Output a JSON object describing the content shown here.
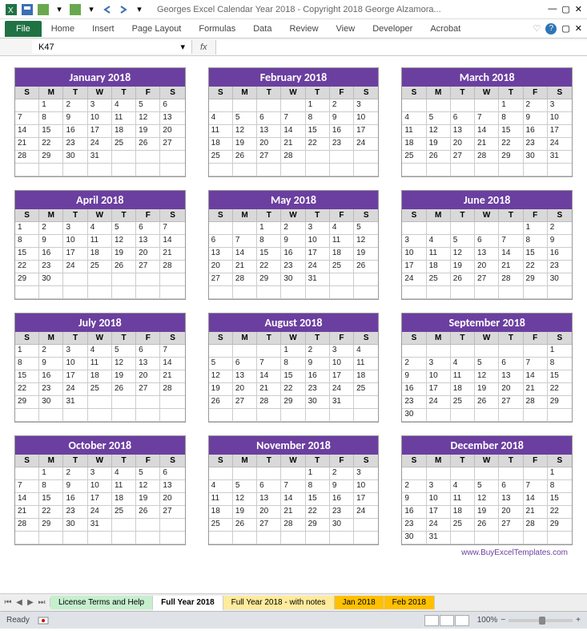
{
  "window_title": "Georges Excel Calendar Year 2018  -  Copyright 2018 George Alzamora...",
  "ribbon": {
    "file": "File",
    "tabs": [
      "Home",
      "Insert",
      "Page Layout",
      "Formulas",
      "Data",
      "Review",
      "View",
      "Developer",
      "Acrobat"
    ]
  },
  "namebox": "K47",
  "fx": "fx",
  "dow": [
    "S",
    "M",
    "T",
    "W",
    "T",
    "F",
    "S"
  ],
  "months": [
    {
      "title": "January 2018",
      "rows": [
        [
          "",
          "1",
          "2",
          "3",
          "4",
          "5",
          "6"
        ],
        [
          "7",
          "8",
          "9",
          "10",
          "11",
          "12",
          "13"
        ],
        [
          "14",
          "15",
          "16",
          "17",
          "18",
          "19",
          "20"
        ],
        [
          "21",
          "22",
          "23",
          "24",
          "25",
          "26",
          "27"
        ],
        [
          "28",
          "29",
          "30",
          "31",
          "",
          "",
          ""
        ],
        [
          "",
          "",
          "",
          "",
          "",
          "",
          ""
        ]
      ]
    },
    {
      "title": "February 2018",
      "rows": [
        [
          "",
          "",
          "",
          "",
          "1",
          "2",
          "3"
        ],
        [
          "4",
          "5",
          "6",
          "7",
          "8",
          "9",
          "10"
        ],
        [
          "11",
          "12",
          "13",
          "14",
          "15",
          "16",
          "17"
        ],
        [
          "18",
          "19",
          "20",
          "21",
          "22",
          "23",
          "24"
        ],
        [
          "25",
          "26",
          "27",
          "28",
          "",
          "",
          ""
        ],
        [
          "",
          "",
          "",
          "",
          "",
          "",
          ""
        ]
      ]
    },
    {
      "title": "March 2018",
      "rows": [
        [
          "",
          "",
          "",
          "",
          "1",
          "2",
          "3"
        ],
        [
          "4",
          "5",
          "6",
          "7",
          "8",
          "9",
          "10"
        ],
        [
          "11",
          "12",
          "13",
          "14",
          "15",
          "16",
          "17"
        ],
        [
          "18",
          "19",
          "20",
          "21",
          "22",
          "23",
          "24"
        ],
        [
          "25",
          "26",
          "27",
          "28",
          "29",
          "30",
          "31"
        ],
        [
          "",
          "",
          "",
          "",
          "",
          "",
          ""
        ]
      ]
    },
    {
      "title": "April 2018",
      "rows": [
        [
          "1",
          "2",
          "3",
          "4",
          "5",
          "6",
          "7"
        ],
        [
          "8",
          "9",
          "10",
          "11",
          "12",
          "13",
          "14"
        ],
        [
          "15",
          "16",
          "17",
          "18",
          "19",
          "20",
          "21"
        ],
        [
          "22",
          "23",
          "24",
          "25",
          "26",
          "27",
          "28"
        ],
        [
          "29",
          "30",
          "",
          "",
          "",
          "",
          ""
        ],
        [
          "",
          "",
          "",
          "",
          "",
          "",
          ""
        ]
      ]
    },
    {
      "title": "May 2018",
      "rows": [
        [
          "",
          "",
          "1",
          "2",
          "3",
          "4",
          "5"
        ],
        [
          "6",
          "7",
          "8",
          "9",
          "10",
          "11",
          "12"
        ],
        [
          "13",
          "14",
          "15",
          "16",
          "17",
          "18",
          "19"
        ],
        [
          "20",
          "21",
          "22",
          "23",
          "24",
          "25",
          "26"
        ],
        [
          "27",
          "28",
          "29",
          "30",
          "31",
          "",
          ""
        ],
        [
          "",
          "",
          "",
          "",
          "",
          "",
          ""
        ]
      ]
    },
    {
      "title": "June 2018",
      "rows": [
        [
          "",
          "",
          "",
          "",
          "",
          "1",
          "2"
        ],
        [
          "3",
          "4",
          "5",
          "6",
          "7",
          "8",
          "9"
        ],
        [
          "10",
          "11",
          "12",
          "13",
          "14",
          "15",
          "16"
        ],
        [
          "17",
          "18",
          "19",
          "20",
          "21",
          "22",
          "23"
        ],
        [
          "24",
          "25",
          "26",
          "27",
          "28",
          "29",
          "30"
        ],
        [
          "",
          "",
          "",
          "",
          "",
          "",
          ""
        ]
      ]
    },
    {
      "title": "July 2018",
      "rows": [
        [
          "1",
          "2",
          "3",
          "4",
          "5",
          "6",
          "7"
        ],
        [
          "8",
          "9",
          "10",
          "11",
          "12",
          "13",
          "14"
        ],
        [
          "15",
          "16",
          "17",
          "18",
          "19",
          "20",
          "21"
        ],
        [
          "22",
          "23",
          "24",
          "25",
          "26",
          "27",
          "28"
        ],
        [
          "29",
          "30",
          "31",
          "",
          "",
          "",
          ""
        ],
        [
          "",
          "",
          "",
          "",
          "",
          "",
          ""
        ]
      ]
    },
    {
      "title": "August 2018",
      "rows": [
        [
          "",
          "",
          "",
          "1",
          "2",
          "3",
          "4"
        ],
        [
          "5",
          "6",
          "7",
          "8",
          "9",
          "10",
          "11"
        ],
        [
          "12",
          "13",
          "14",
          "15",
          "16",
          "17",
          "18"
        ],
        [
          "19",
          "20",
          "21",
          "22",
          "23",
          "24",
          "25"
        ],
        [
          "26",
          "27",
          "28",
          "29",
          "30",
          "31",
          ""
        ],
        [
          "",
          "",
          "",
          "",
          "",
          "",
          ""
        ]
      ]
    },
    {
      "title": "September 2018",
      "rows": [
        [
          "",
          "",
          "",
          "",
          "",
          "",
          "1"
        ],
        [
          "2",
          "3",
          "4",
          "5",
          "6",
          "7",
          "8"
        ],
        [
          "9",
          "10",
          "11",
          "12",
          "13",
          "14",
          "15"
        ],
        [
          "16",
          "17",
          "18",
          "19",
          "20",
          "21",
          "22"
        ],
        [
          "23",
          "24",
          "25",
          "26",
          "27",
          "28",
          "29"
        ],
        [
          "30",
          "",
          "",
          "",
          "",
          "",
          ""
        ]
      ]
    },
    {
      "title": "October 2018",
      "rows": [
        [
          "",
          "1",
          "2",
          "3",
          "4",
          "5",
          "6"
        ],
        [
          "7",
          "8",
          "9",
          "10",
          "11",
          "12",
          "13"
        ],
        [
          "14",
          "15",
          "16",
          "17",
          "18",
          "19",
          "20"
        ],
        [
          "21",
          "22",
          "23",
          "24",
          "25",
          "26",
          "27"
        ],
        [
          "28",
          "29",
          "30",
          "31",
          "",
          "",
          ""
        ],
        [
          "",
          "",
          "",
          "",
          "",
          "",
          ""
        ]
      ]
    },
    {
      "title": "November 2018",
      "rows": [
        [
          "",
          "",
          "",
          "",
          "1",
          "2",
          "3"
        ],
        [
          "4",
          "5",
          "6",
          "7",
          "8",
          "9",
          "10"
        ],
        [
          "11",
          "12",
          "13",
          "14",
          "15",
          "16",
          "17"
        ],
        [
          "18",
          "19",
          "20",
          "21",
          "22",
          "23",
          "24"
        ],
        [
          "25",
          "26",
          "27",
          "28",
          "29",
          "30",
          ""
        ],
        [
          "",
          "",
          "",
          "",
          "",
          "",
          ""
        ]
      ]
    },
    {
      "title": "December 2018",
      "rows": [
        [
          "",
          "",
          "",
          "",
          "",
          "",
          "1"
        ],
        [
          "2",
          "3",
          "4",
          "5",
          "6",
          "7",
          "8"
        ],
        [
          "9",
          "10",
          "11",
          "12",
          "13",
          "14",
          "15"
        ],
        [
          "16",
          "17",
          "18",
          "19",
          "20",
          "21",
          "22"
        ],
        [
          "23",
          "24",
          "25",
          "26",
          "27",
          "28",
          "29"
        ],
        [
          "30",
          "31",
          "",
          "",
          "",
          "",
          ""
        ]
      ]
    }
  ],
  "footer_link": "www.BuyExcelTemplates.com",
  "sheet_tabs": {
    "t1": "License Terms and Help",
    "t2": "Full Year 2018",
    "t3": "Full Year 2018 - with notes",
    "t4": "Jan 2018",
    "t5": "Feb 2018"
  },
  "status": {
    "ready": "Ready",
    "zoom": "100%"
  }
}
